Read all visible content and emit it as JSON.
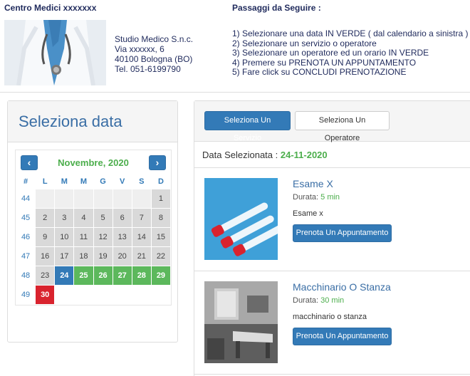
{
  "header": {
    "brand": "Centro Medici xxxxxxx",
    "address": [
      "Studio Medico S.n.c.",
      "Via xxxxxx, 6",
      "40100 Bologna (BO)",
      "Tel. 051-6199790"
    ],
    "steps_title": "Passaggi da Seguire :",
    "steps": [
      "1) Selezionare una data IN VERDE ( dal calendario a sinistra )",
      "2) Selezionare un servizio o operatore",
      "3) Selezionare un operatore ed un orario IN VERDE",
      "4) Premere su PRENOTA UN APPUNTAMENTO",
      "5) Fare click su CONCLUDI PRENOTAZIONE"
    ]
  },
  "date_panel": {
    "title": "Seleziona data",
    "month_label": "Novembre, 2020",
    "prev_icon": "‹",
    "next_icon": "›",
    "weekday_headers": [
      "#",
      "L",
      "M",
      "M",
      "G",
      "V",
      "S",
      "D"
    ],
    "weeks": [
      {
        "week": "44",
        "days": [
          {
            "d": "",
            "s": "empty"
          },
          {
            "d": "",
            "s": "empty"
          },
          {
            "d": "",
            "s": "empty"
          },
          {
            "d": "",
            "s": "empty"
          },
          {
            "d": "",
            "s": "empty"
          },
          {
            "d": "",
            "s": "empty"
          },
          {
            "d": "1",
            "s": "gray"
          }
        ]
      },
      {
        "week": "45",
        "days": [
          {
            "d": "2",
            "s": "gray"
          },
          {
            "d": "3",
            "s": "gray"
          },
          {
            "d": "4",
            "s": "gray"
          },
          {
            "d": "5",
            "s": "gray"
          },
          {
            "d": "6",
            "s": "gray"
          },
          {
            "d": "7",
            "s": "gray"
          },
          {
            "d": "8",
            "s": "gray"
          }
        ]
      },
      {
        "week": "46",
        "days": [
          {
            "d": "9",
            "s": "gray"
          },
          {
            "d": "10",
            "s": "gray"
          },
          {
            "d": "11",
            "s": "gray"
          },
          {
            "d": "12",
            "s": "gray"
          },
          {
            "d": "13",
            "s": "gray"
          },
          {
            "d": "14",
            "s": "gray"
          },
          {
            "d": "15",
            "s": "gray"
          }
        ]
      },
      {
        "week": "47",
        "days": [
          {
            "d": "16",
            "s": "gray"
          },
          {
            "d": "17",
            "s": "gray"
          },
          {
            "d": "18",
            "s": "gray"
          },
          {
            "d": "19",
            "s": "gray"
          },
          {
            "d": "20",
            "s": "gray"
          },
          {
            "d": "21",
            "s": "gray"
          },
          {
            "d": "22",
            "s": "gray"
          }
        ]
      },
      {
        "week": "48",
        "days": [
          {
            "d": "23",
            "s": "gray"
          },
          {
            "d": "24",
            "s": "blue"
          },
          {
            "d": "25",
            "s": "green"
          },
          {
            "d": "26",
            "s": "green"
          },
          {
            "d": "27",
            "s": "green"
          },
          {
            "d": "28",
            "s": "green"
          },
          {
            "d": "29",
            "s": "green"
          }
        ]
      },
      {
        "week": "49",
        "days": [
          {
            "d": "30",
            "s": "red"
          },
          {
            "d": "",
            "s": "blank"
          },
          {
            "d": "",
            "s": "blank"
          },
          {
            "d": "",
            "s": "blank"
          },
          {
            "d": "",
            "s": "blank"
          },
          {
            "d": "",
            "s": "blank"
          },
          {
            "d": "",
            "s": "blank"
          }
        ]
      }
    ]
  },
  "service_panel": {
    "btn_service": "Seleziona Un Servizio",
    "btn_operator": "Seleziona Un Operatore",
    "selected_date_label": "Data Selezionata :",
    "selected_date_value": "24-11-2020",
    "items": [
      {
        "title": "Esame X",
        "duration_label": "Durata:",
        "duration": "5 min",
        "description": "Esame x",
        "book_label": "Prenota Un Appuntamento"
      },
      {
        "title": "Macchinario O Stanza",
        "duration_label": "Durata:",
        "duration": "30 min",
        "description": "macchinario o stanza",
        "book_label": "Prenota Un Appuntamento"
      }
    ]
  },
  "colors": {
    "primary": "#337ab7",
    "available": "#5cb85c",
    "selected": "#337ab7",
    "unavailable": "#d9232e",
    "past": "#d9d9d9"
  }
}
